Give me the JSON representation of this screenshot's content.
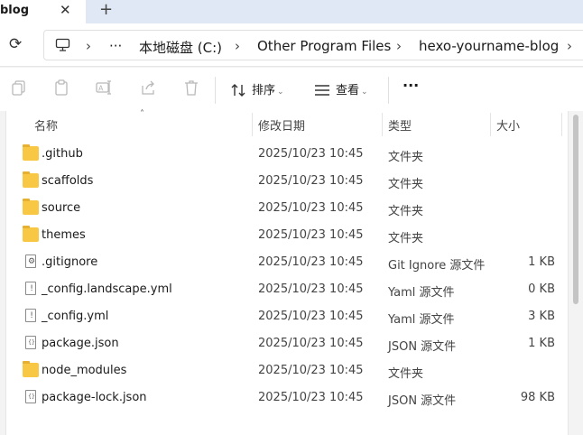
{
  "tab": {
    "title": "blog",
    "close_icon": "close-icon",
    "new_tab_icon": "plus-icon"
  },
  "address": {
    "refresh_icon": "refresh-icon",
    "pc_icon": "computer-icon",
    "ellipsis": "···",
    "crumbs": [
      "本地磁盘 (C:)",
      "Other Program Files",
      "hexo-yourname-blog"
    ]
  },
  "commands": {
    "icons": [
      "copy-icon",
      "paste-icon",
      "rename-icon",
      "share-icon",
      "delete-icon"
    ],
    "sort_label": "排序",
    "view_label": "查看",
    "more": "···"
  },
  "columns": {
    "name": "名称",
    "date": "修改日期",
    "type": "类型",
    "size": "大小"
  },
  "files": [
    {
      "name": ".github",
      "date": "2025/10/23 10:45",
      "type": "文件夹",
      "size": "",
      "icon": "folder-icon"
    },
    {
      "name": "scaffolds",
      "date": "2025/10/23 10:45",
      "type": "文件夹",
      "size": "",
      "icon": "folder-icon"
    },
    {
      "name": "source",
      "date": "2025/10/23 10:45",
      "type": "文件夹",
      "size": "",
      "icon": "folder-icon"
    },
    {
      "name": "themes",
      "date": "2025/10/23 10:45",
      "type": "文件夹",
      "size": "",
      "icon": "folder-icon"
    },
    {
      "name": ".gitignore",
      "date": "2025/10/23 10:45",
      "type": "Git Ignore 源文件",
      "size": "1 KB",
      "icon": "settings-file-icon"
    },
    {
      "name": "_config.landscape.yml",
      "date": "2025/10/23 10:45",
      "type": "Yaml 源文件",
      "size": "0 KB",
      "icon": "yaml-file-icon"
    },
    {
      "name": "_config.yml",
      "date": "2025/10/23 10:45",
      "type": "Yaml 源文件",
      "size": "3 KB",
      "icon": "yaml-file-icon"
    },
    {
      "name": "package.json",
      "date": "2025/10/23 10:45",
      "type": "JSON 源文件",
      "size": "1 KB",
      "icon": "json-file-icon"
    },
    {
      "name": "node_modules",
      "date": "2025/10/23 10:45",
      "type": "文件夹",
      "size": "",
      "icon": "folder-icon"
    },
    {
      "name": "package-lock.json",
      "date": "2025/10/23 10:45",
      "type": "JSON 源文件",
      "size": "98 KB",
      "icon": "json-file-icon"
    }
  ]
}
